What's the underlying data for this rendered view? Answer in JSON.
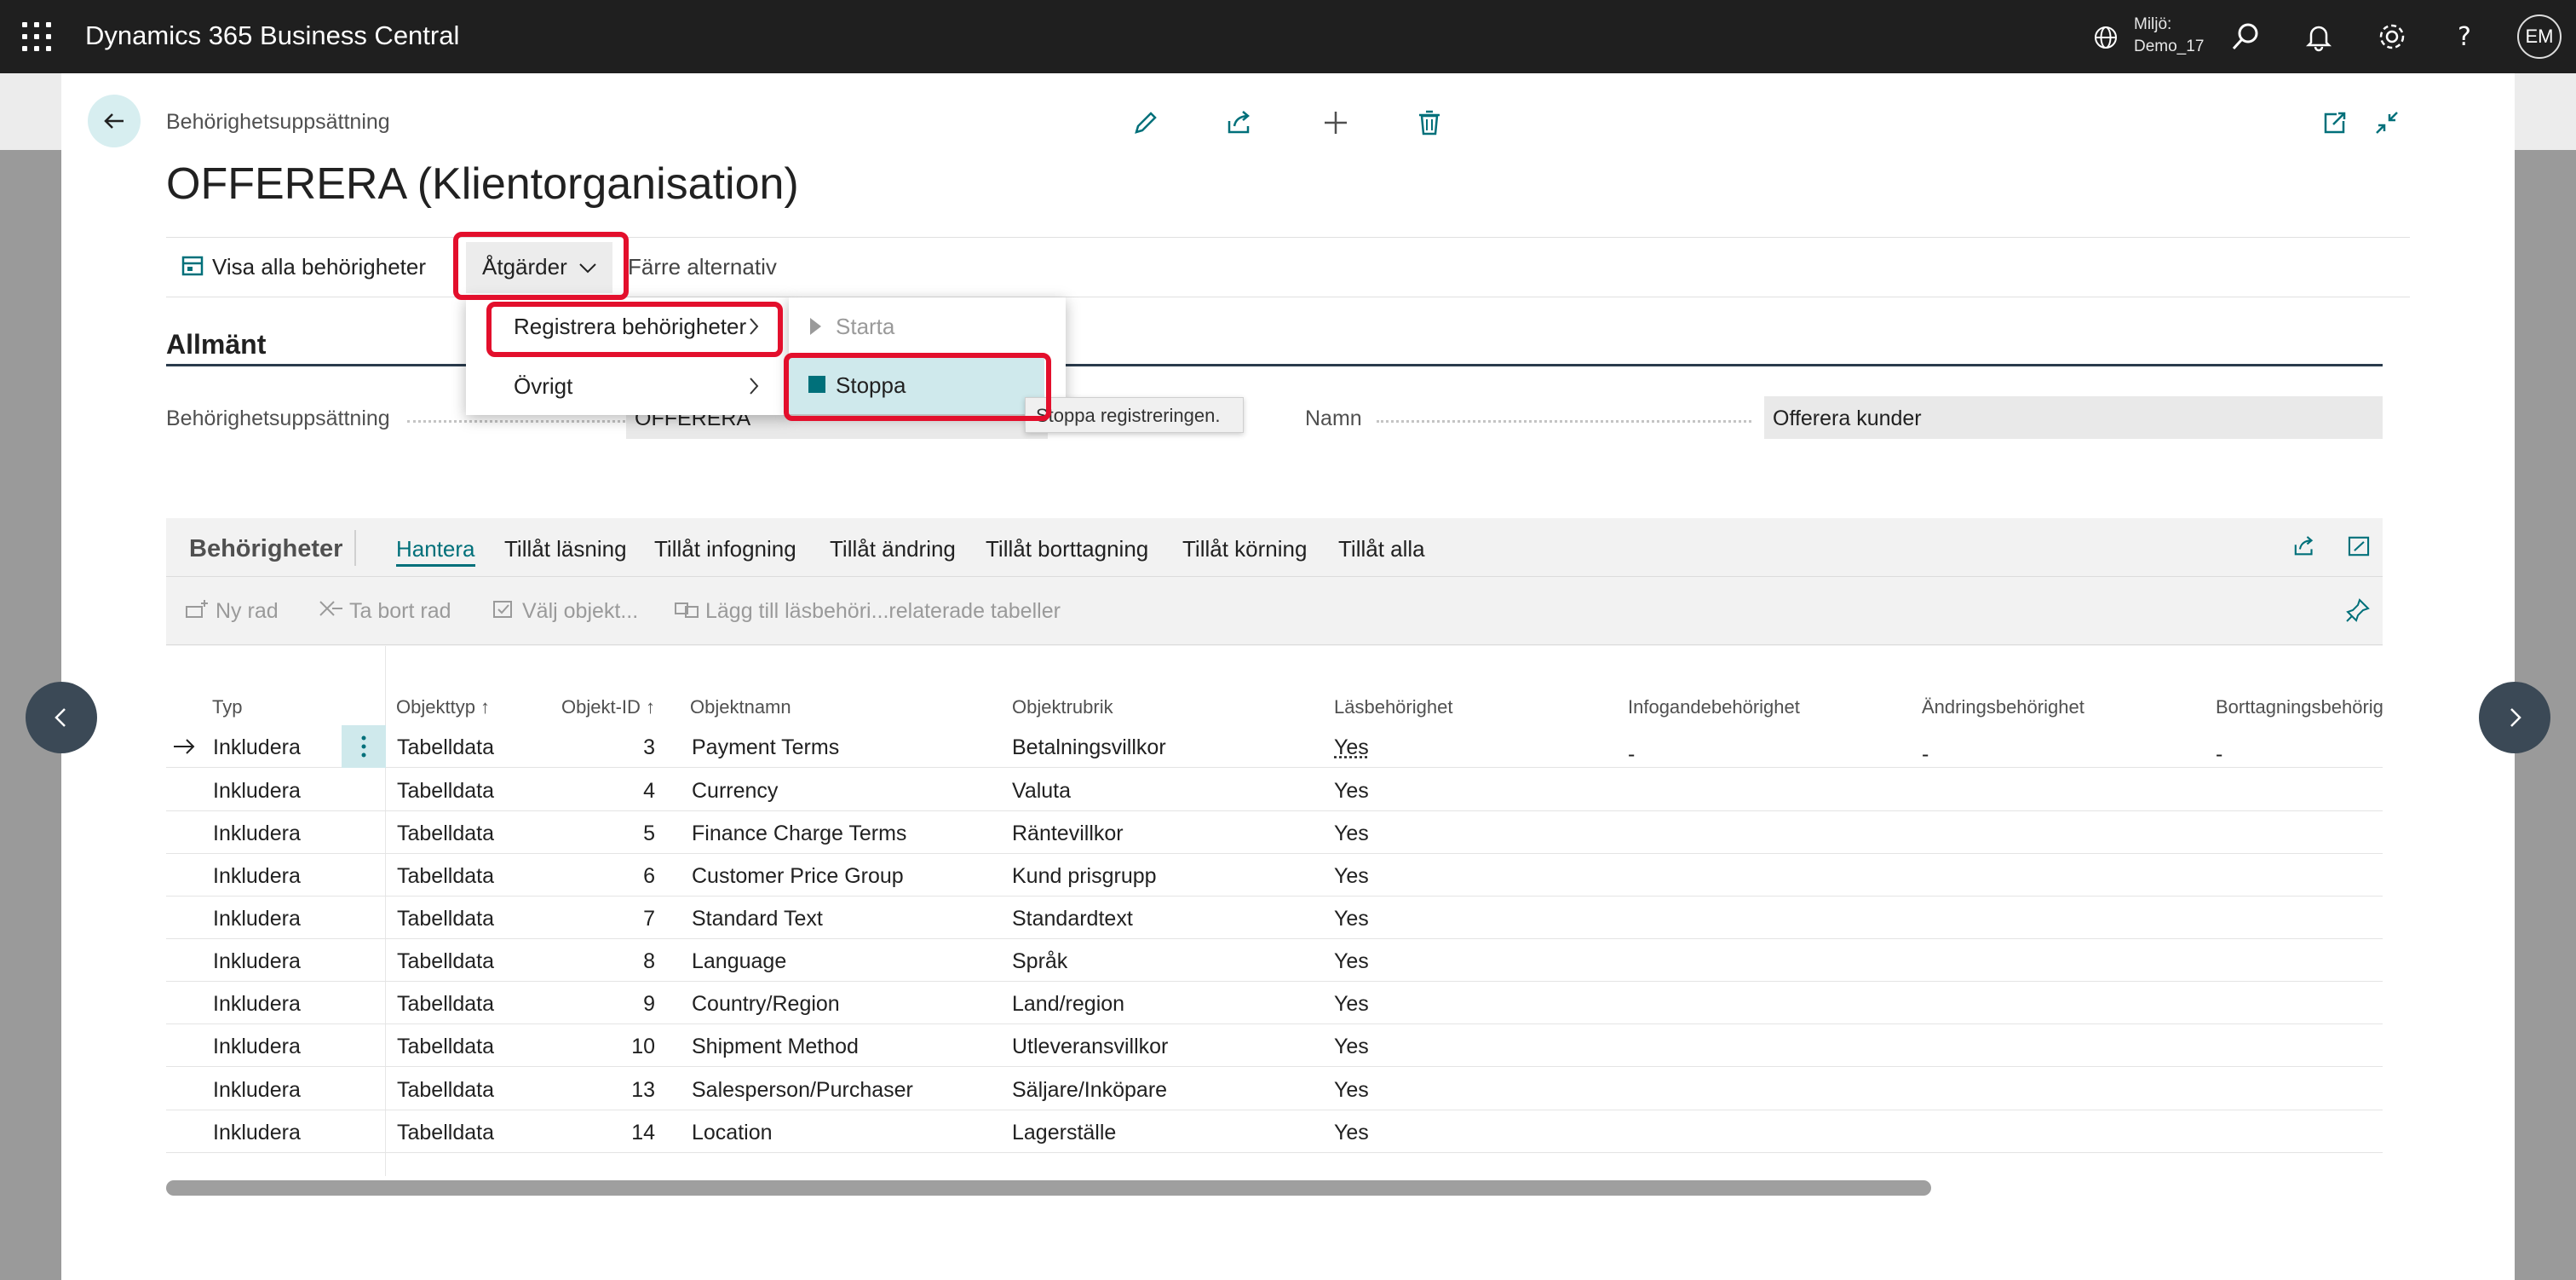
{
  "topbar": {
    "app_title": "Dynamics 365 Business Central",
    "env_label": "Miljö:",
    "env_value": "Demo_17",
    "avatar_initials": "EM"
  },
  "page": {
    "breadcrumb": "Behörighetsuppsättning",
    "title": "OFFERERA (Klientorganisation)"
  },
  "actionbar": {
    "show_all": "Visa alla behörigheter",
    "actions": "Åtgärder",
    "fewer": "Färre alternativ"
  },
  "menu": {
    "register": "Registrera behörigheter",
    "other": "Övrigt",
    "start": "Starta",
    "stop": "Stoppa",
    "tooltip": "Stoppa registreringen."
  },
  "general": {
    "section_title": "Allmänt",
    "permset_label": "Behörighetsuppsättning",
    "permset_value": "OFFERERA",
    "name_label": "Namn",
    "name_value": "Offerera kunder"
  },
  "permissions": {
    "title": "Behörigheter",
    "tabs": [
      "Hantera",
      "Tillåt läsning",
      "Tillåt infogning",
      "Tillåt ändring",
      "Tillåt borttagning",
      "Tillåt körning",
      "Tillåt alla"
    ],
    "commands": [
      "Ny rad",
      "Ta bort rad",
      "Välj objekt...",
      "Lägg till läsbehöri...relaterade tabeller"
    ],
    "columns": [
      "Typ",
      "Objekttyp ↑",
      "Objekt-ID ↑",
      "Objektnamn",
      "Objektrubrik",
      "Läsbehörighet",
      "Infogandebehörighet",
      "Ändringsbehörighet",
      "Borttagningsbehörig"
    ],
    "rows": [
      {
        "typ": "Inkludera",
        "objekttyp": "Tabelldata",
        "id": "3",
        "namn": "Payment Terms",
        "rubrik": "Betalningsvillkor",
        "las": "Yes",
        "infoga": "-",
        "andra": "-",
        "bort": "-"
      },
      {
        "typ": "Inkludera",
        "objekttyp": "Tabelldata",
        "id": "4",
        "namn": "Currency",
        "rubrik": "Valuta",
        "las": "Yes",
        "infoga": "",
        "andra": "",
        "bort": ""
      },
      {
        "typ": "Inkludera",
        "objekttyp": "Tabelldata",
        "id": "5",
        "namn": "Finance Charge Terms",
        "rubrik": "Räntevillkor",
        "las": "Yes",
        "infoga": "",
        "andra": "",
        "bort": ""
      },
      {
        "typ": "Inkludera",
        "objekttyp": "Tabelldata",
        "id": "6",
        "namn": "Customer Price Group",
        "rubrik": "Kund prisgrupp",
        "las": "Yes",
        "infoga": "",
        "andra": "",
        "bort": ""
      },
      {
        "typ": "Inkludera",
        "objekttyp": "Tabelldata",
        "id": "7",
        "namn": "Standard Text",
        "rubrik": "Standardtext",
        "las": "Yes",
        "infoga": "",
        "andra": "",
        "bort": ""
      },
      {
        "typ": "Inkludera",
        "objekttyp": "Tabelldata",
        "id": "8",
        "namn": "Language",
        "rubrik": "Språk",
        "las": "Yes",
        "infoga": "",
        "andra": "",
        "bort": ""
      },
      {
        "typ": "Inkludera",
        "objekttyp": "Tabelldata",
        "id": "9",
        "namn": "Country/Region",
        "rubrik": "Land/region",
        "las": "Yes",
        "infoga": "",
        "andra": "",
        "bort": ""
      },
      {
        "typ": "Inkludera",
        "objekttyp": "Tabelldata",
        "id": "10",
        "namn": "Shipment Method",
        "rubrik": "Utleveransvillkor",
        "las": "Yes",
        "infoga": "",
        "andra": "",
        "bort": ""
      },
      {
        "typ": "Inkludera",
        "objekttyp": "Tabelldata",
        "id": "13",
        "namn": "Salesperson/Purchaser",
        "rubrik": "Säljare/Inköpare",
        "las": "Yes",
        "infoga": "",
        "andra": "",
        "bort": ""
      },
      {
        "typ": "Inkludera",
        "objekttyp": "Tabelldata",
        "id": "14",
        "namn": "Location",
        "rubrik": "Lagerställe",
        "las": "Yes",
        "infoga": "",
        "andra": "",
        "bort": ""
      }
    ]
  },
  "colors": {
    "topbar": "#1f1f1f",
    "accent": "#00707a",
    "highlight": "#e30f2c",
    "selected": "#cfe9ec"
  }
}
